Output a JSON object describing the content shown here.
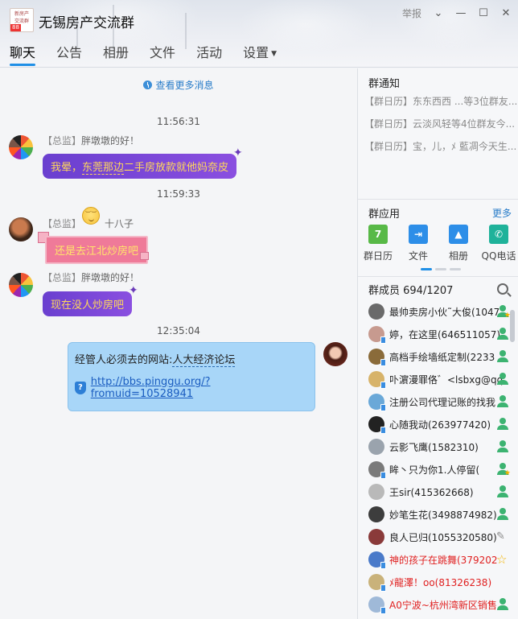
{
  "window": {
    "title": "无锡房产交流群",
    "report_label": "举报",
    "group_avatar_text": "新房产\n交流群",
    "group_avatar_level": "88"
  },
  "tabs": [
    {
      "label": "聊天",
      "active": true
    },
    {
      "label": "公告"
    },
    {
      "label": "相册"
    },
    {
      "label": "文件"
    },
    {
      "label": "活动"
    },
    {
      "label": "设置"
    }
  ],
  "chat": {
    "view_more": "查看更多消息",
    "messages": [
      {
        "time": "11:56:31",
        "role": "【总监】",
        "sender": "胖墩墩的好！",
        "text_pre": "我晕，",
        "text_link": "东莞那边",
        "text_post": "二手房放款就他妈奈皮"
      },
      {
        "time": "11:59:33",
        "role": "【总监】",
        "sender": "十八子",
        "text": "还是去江北炒房吧"
      },
      {
        "role": "【总监】",
        "sender": "胖墩墩的好！",
        "text": "现在没人炒房吧"
      },
      {
        "time": "12:35:04",
        "text_pre": "经管人必须去的网站:",
        "text_link": "人大经济论坛",
        "url": "http://bbs.pinggu.org/?fromuid=10528941"
      }
    ]
  },
  "notice": {
    "title": "群通知",
    "items": [
      "【群日历】东东西西 ...等3位群友...",
      "【群日历】云淡风轻等4位群友今...",
      "【群日历】宝，儿，ﾒ 藍凋今天生..."
    ]
  },
  "apps": {
    "title": "群应用",
    "more": "更多",
    "items": [
      {
        "label": "群日历",
        "color": "#58b947",
        "glyph": "7"
      },
      {
        "label": "文件",
        "color": "#2d8ee8",
        "glyph": "⇥"
      },
      {
        "label": "相册",
        "color": "#2d8ee8",
        "glyph": "▲"
      },
      {
        "label": "QQ电话",
        "color": "#1fb29a",
        "glyph": "✆"
      }
    ]
  },
  "members": {
    "title": "群成员 694/1207",
    "list": [
      {
        "name": "最帅卖房小伙˜大俊(1047",
        "badge": "person-star",
        "avatar": "#6a6a6a"
      },
      {
        "name": "婷，在这里(646511057)",
        "badge": "person",
        "avatar": "#c79a8f",
        "device": true
      },
      {
        "name": "高档手绘墙纸定制(2233",
        "badge": "person",
        "avatar": "#8a6b3a",
        "device": true
      },
      {
        "name": "卟濵漫罪佫゛<lsbxg@qq",
        "badge": "person",
        "avatar": "#d7b36a",
        "device": true
      },
      {
        "name": "注册公司代理记账的找我",
        "badge": "person",
        "avatar": "#6aa8d8",
        "device": true
      },
      {
        "name": "心随我动(263977420)",
        "badge": "person",
        "avatar": "#222222",
        "device": true
      },
      {
        "name": "云影飞鹰(1582310)",
        "badge": "person",
        "avatar": "#9aa3ad"
      },
      {
        "name": "眸丶只为你1.人停留(",
        "badge": "person-star",
        "avatar": "#7a7a7a",
        "device": true
      },
      {
        "name": "王sir(415362668)",
        "badge": "person",
        "avatar": "#b9b9b9"
      },
      {
        "name": "妙笔生花(3498874982)",
        "badge": "person",
        "avatar": "#3d3d3d"
      },
      {
        "name": "良人已归(1055320580)",
        "badge": "pencil",
        "avatar": "#8a3a3a"
      },
      {
        "name": "神的孩子在跳舞(379202",
        "badge": "star",
        "avatar": "#4a7ac9",
        "red": true,
        "device": true
      },
      {
        "name": "ﾒ龍澤！oo(81326238)",
        "badge": "none",
        "avatar": "#c9b27a",
        "red": true,
        "device": true
      },
      {
        "name": "A0宁波~杭州湾新区销售",
        "badge": "person",
        "avatar": "#9fb9d8",
        "red": true,
        "device": true
      }
    ]
  }
}
